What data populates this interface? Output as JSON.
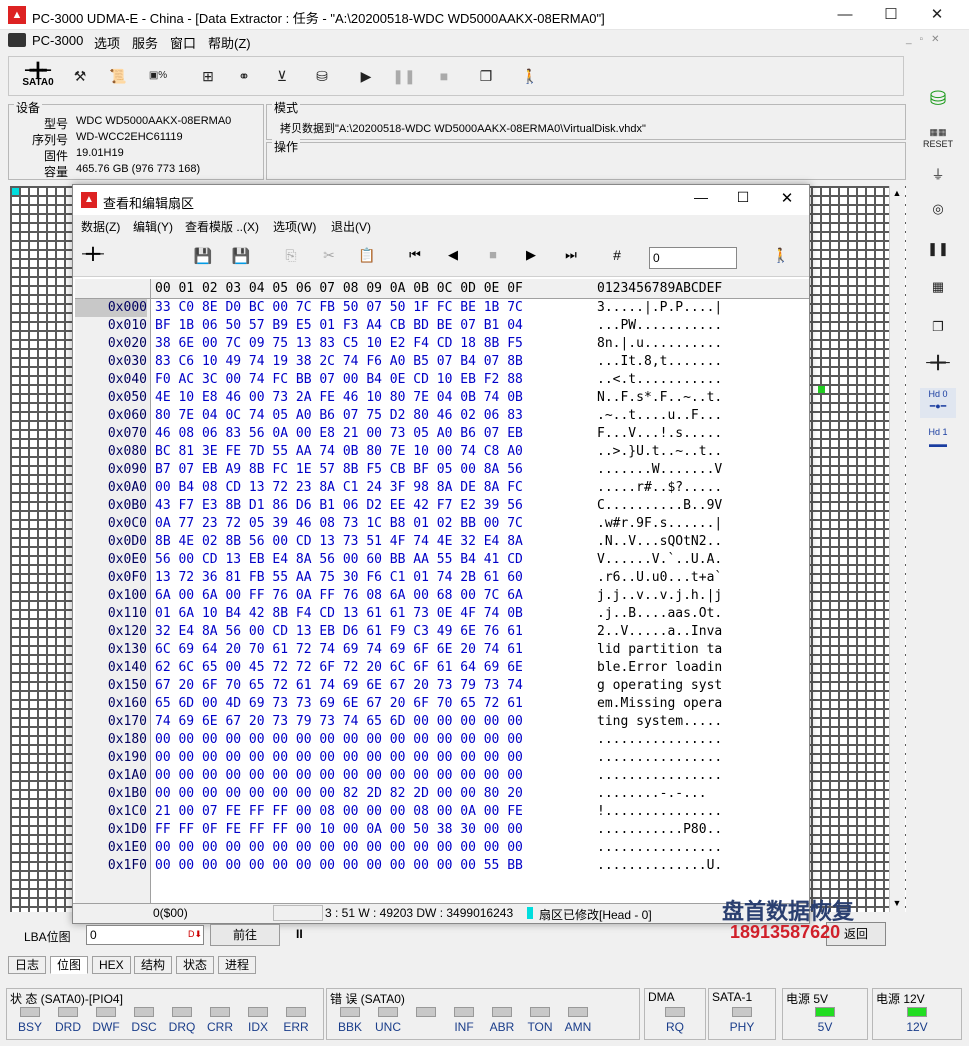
{
  "window": {
    "title": "PC-3000 UDMA-E - China - [Data Extractor : 任务 - \"A:\\20200518-WDC WD5000AAKX-08ERMA0\"]",
    "min": "—",
    "max": "☐",
    "close": "✕"
  },
  "menu": [
    "PC-3000",
    "选项",
    "服务",
    "窗口",
    "帮助(Z)"
  ],
  "toolbar": {
    "sata_label": "SATA0"
  },
  "device": {
    "section": "设备",
    "fields": [
      {
        "k": "型号",
        "v": "WDC WD5000AAKX-08ERMA0"
      },
      {
        "k": "序列号",
        "v": "WD-WCC2EHC61119"
      },
      {
        "k": "固件",
        "v": "19.01H19"
      },
      {
        "k": "容量",
        "v": "465.76 GB (976 773 168)"
      }
    ]
  },
  "mode": {
    "section": "模式",
    "text": "拷贝数据到\"A:\\20200518-WDC WD5000AAKX-08ERMA0\\VirtualDisk.vhdx\""
  },
  "operation": {
    "section": "操作"
  },
  "dialog": {
    "title": "查看和编辑扇区",
    "menu": [
      "数据(Z)",
      "编辑(Y)",
      "查看模版 ..(X)",
      "选项(W)",
      "退出(V)"
    ],
    "input_value": "0",
    "header_hex": "00 01 02 03 04 05 06 07 08 09 0A 0B 0C 0D 0E 0F",
    "header_ascii": "0123456789ABCDEF",
    "rows": [
      {
        "o": "0x000",
        "h": "33 C0 8E D0 BC 00 7C FB 50 07 50 1F FC BE 1B 7C",
        "a": "3.....|.P.P....|"
      },
      {
        "o": "0x010",
        "h": "BF 1B 06 50 57 B9 E5 01 F3 A4 CB BD BE 07 B1 04",
        "a": "...PW..........."
      },
      {
        "o": "0x020",
        "h": "38 6E 00 7C 09 75 13 83 C5 10 E2 F4 CD 18 8B F5",
        "a": "8n.|.u.........."
      },
      {
        "o": "0x030",
        "h": "83 C6 10 49 74 19 38 2C 74 F6 A0 B5 07 B4 07 8B",
        "a": "...It.8,t......."
      },
      {
        "o": "0x040",
        "h": "F0 AC 3C 00 74 FC BB 07 00 B4 0E CD 10 EB F2 88",
        "a": "..<.t..........."
      },
      {
        "o": "0x050",
        "h": "4E 10 E8 46 00 73 2A FE 46 10 80 7E 04 0B 74 0B",
        "a": "N..F.s*.F..~..t."
      },
      {
        "o": "0x060",
        "h": "80 7E 04 0C 74 05 A0 B6 07 75 D2 80 46 02 06 83",
        "a": ".~..t....u..F..."
      },
      {
        "o": "0x070",
        "h": "46 08 06 83 56 0A 00 E8 21 00 73 05 A0 B6 07 EB",
        "a": "F...V...!.s....."
      },
      {
        "o": "0x080",
        "h": "BC 81 3E FE 7D 55 AA 74 0B 80 7E 10 00 74 C8 A0",
        "a": "..>.}U.t..~..t.."
      },
      {
        "o": "0x090",
        "h": "B7 07 EB A9 8B FC 1E 57 8B F5 CB BF 05 00 8A 56",
        "a": ".......W.......V"
      },
      {
        "o": "0x0A0",
        "h": "00 B4 08 CD 13 72 23 8A C1 24 3F 98 8A DE 8A FC",
        "a": ".....r#..$?....."
      },
      {
        "o": "0x0B0",
        "h": "43 F7 E3 8B D1 86 D6 B1 06 D2 EE 42 F7 E2 39 56",
        "a": "C..........B..9V"
      },
      {
        "o": "0x0C0",
        "h": "0A 77 23 72 05 39 46 08 73 1C B8 01 02 BB 00 7C",
        "a": ".w#r.9F.s......|"
      },
      {
        "o": "0x0D0",
        "h": "8B 4E 02 8B 56 00 CD 13 73 51 4F 74 4E 32 E4 8A",
        "a": ".N..V...sQOtN2.."
      },
      {
        "o": "0x0E0",
        "h": "56 00 CD 13 EB E4 8A 56 00 60 BB AA 55 B4 41 CD",
        "a": "V......V.`..U.A."
      },
      {
        "o": "0x0F0",
        "h": "13 72 36 81 FB 55 AA 75 30 F6 C1 01 74 2B 61 60",
        "a": ".r6..U.u0...t+a`"
      },
      {
        "o": "0x100",
        "h": "6A 00 6A 00 FF 76 0A FF 76 08 6A 00 68 00 7C 6A",
        "a": "j.j..v..v.j.h.|j"
      },
      {
        "o": "0x110",
        "h": "01 6A 10 B4 42 8B F4 CD 13 61 61 73 0E 4F 74 0B",
        "a": ".j..B....aas.Ot."
      },
      {
        "o": "0x120",
        "h": "32 E4 8A 56 00 CD 13 EB D6 61 F9 C3 49 6E 76 61",
        "a": "2..V.....a..Inva"
      },
      {
        "o": "0x130",
        "h": "6C 69 64 20 70 61 72 74 69 74 69 6F 6E 20 74 61",
        "a": "lid partition ta"
      },
      {
        "o": "0x140",
        "h": "62 6C 65 00 45 72 72 6F 72 20 6C 6F 61 64 69 6E",
        "a": "ble.Error loadin"
      },
      {
        "o": "0x150",
        "h": "67 20 6F 70 65 72 61 74 69 6E 67 20 73 79 73 74",
        "a": "g operating syst"
      },
      {
        "o": "0x160",
        "h": "65 6D 00 4D 69 73 73 69 6E 67 20 6F 70 65 72 61",
        "a": "em.Missing opera"
      },
      {
        "o": "0x170",
        "h": "74 69 6E 67 20 73 79 73 74 65 6D 00 00 00 00 00",
        "a": "ting system....."
      },
      {
        "o": "0x180",
        "h": "00 00 00 00 00 00 00 00 00 00 00 00 00 00 00 00",
        "a": "................"
      },
      {
        "o": "0x190",
        "h": "00 00 00 00 00 00 00 00 00 00 00 00 00 00 00 00",
        "a": "................"
      },
      {
        "o": "0x1A0",
        "h": "00 00 00 00 00 00 00 00 00 00 00 00 00 00 00 00",
        "a": "................"
      },
      {
        "o": "0x1B0",
        "h": "00 00 00 00 00 00 00 00 82 2D 82 2D 00 00 80 20",
        "a": "........-.-...  "
      },
      {
        "o": "0x1C0",
        "h": "21 00 07 FE FF FF 00 08 00 00 00 08 00 0A 00 FE",
        "a": "!..............."
      },
      {
        "o": "0x1D0",
        "h": "FF FF 0F FE FF FF 00 10 00 0A 00 50 38 30 00 00",
        "a": "...........P80.."
      },
      {
        "o": "0x1E0",
        "h": "00 00 00 00 00 00 00 00 00 00 00 00 00 00 00 00",
        "a": "................"
      },
      {
        "o": "0x1F0",
        "h": "00 00 00 00 00 00 00 00 00 00 00 00 00 00 55 BB",
        "a": "..............U."
      }
    ],
    "status_left": "0($00)",
    "status_mid": "3 : 51 W : 49203 DW : 3499016243",
    "status_right": "扇区已修改[Head - 0]"
  },
  "lba": {
    "label": "LBA位图",
    "value": "0",
    "goto": "前往",
    "pause": "II",
    "back": "返回"
  },
  "tabs": [
    "日志",
    "位图",
    "HEX",
    "结构",
    "状态",
    "进程"
  ],
  "status": {
    "sata_title": "状 态 (SATA0)-[PIO4]",
    "sata_leds": [
      "BSY",
      "DRD",
      "DWF",
      "DSC",
      "DRQ",
      "CRR",
      "IDX",
      "ERR"
    ],
    "err_title": "错 误 (SATA0)",
    "err_leds": [
      "BBK",
      "UNC",
      "",
      "INF",
      "ABR",
      "TON",
      "AMN"
    ],
    "dma_title": "DMA",
    "dma_leds": [
      "RQ"
    ],
    "sata1_title": "SATA-1",
    "sata1_leds": [
      "PHY"
    ],
    "p5_title": "电源 5V",
    "p5_leds": [
      "5V"
    ],
    "p12_title": "电源 12V",
    "p12_leds": [
      "12V"
    ]
  },
  "watermark": {
    "line1": "盘首数据恢复",
    "line2": "18913587620"
  },
  "right_icons": {
    "reset": "RESET",
    "hd0": "Hd 0",
    "hd1": "Hd 1"
  }
}
